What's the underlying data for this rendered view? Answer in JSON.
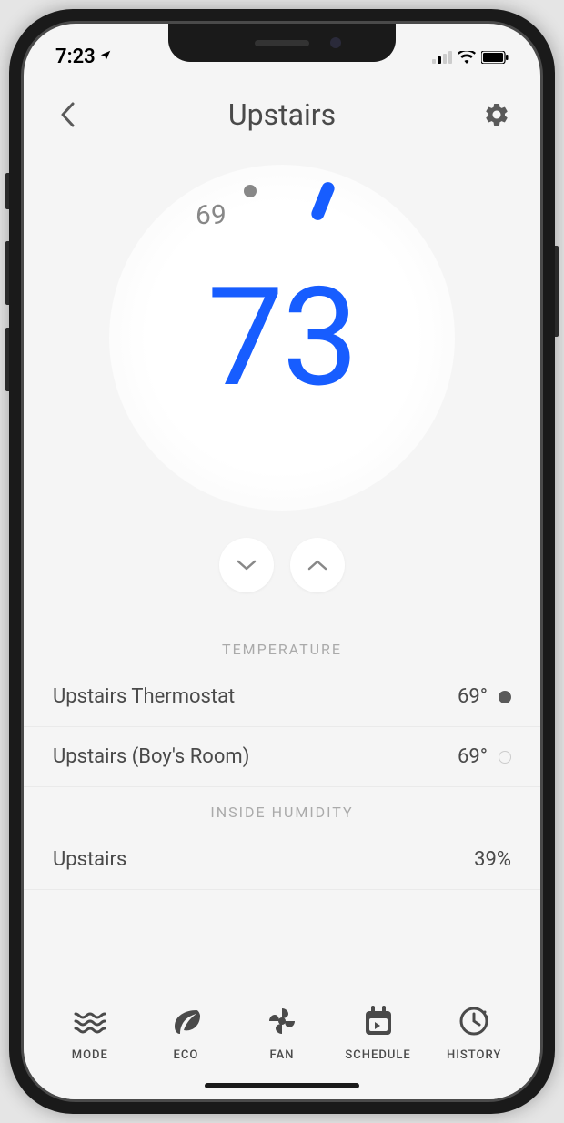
{
  "statusBar": {
    "time": "7:23"
  },
  "header": {
    "title": "Upstairs"
  },
  "dial": {
    "targetTemp": "69",
    "currentTemp": "73"
  },
  "sections": {
    "temperature": {
      "label": "TEMPERATURE",
      "rows": [
        {
          "label": "Upstairs Thermostat",
          "value": "69°",
          "selected": true
        },
        {
          "label": "Upstairs (Boy's Room)",
          "value": "69°",
          "selected": false
        }
      ]
    },
    "humidity": {
      "label": "INSIDE HUMIDITY",
      "rows": [
        {
          "label": "Upstairs",
          "value": "39%"
        }
      ]
    }
  },
  "tabbar": {
    "items": [
      {
        "label": "MODE"
      },
      {
        "label": "ECO"
      },
      {
        "label": "FAN"
      },
      {
        "label": "SCHEDULE"
      },
      {
        "label": "HISTORY"
      }
    ]
  }
}
